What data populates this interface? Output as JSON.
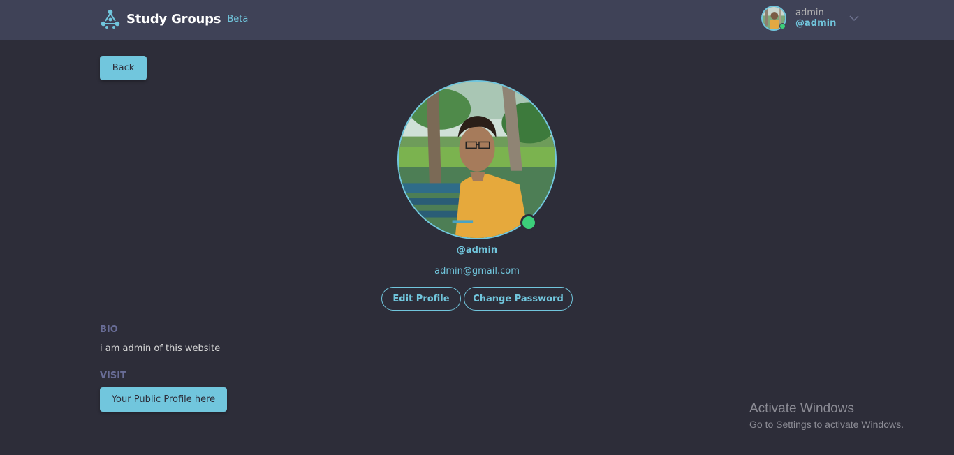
{
  "header": {
    "title": "Study Groups",
    "badge": "Beta",
    "user": {
      "name": "admin",
      "handle": "@admin"
    }
  },
  "actions": {
    "back_label": "Back"
  },
  "profile": {
    "handle": "@admin",
    "email": "admin@gmail.com",
    "status": "online",
    "edit_label": "Edit Profile",
    "password_label": "Change Password"
  },
  "bio": {
    "heading": "BIO",
    "text": "i am admin of this website"
  },
  "visit": {
    "heading": "VISIT",
    "button_label": "Your Public Profile here"
  },
  "watermark": {
    "title": "Activate Windows",
    "subtitle": "Go to Settings to activate Windows."
  },
  "colors": {
    "background": "#2d2d39",
    "header": "#3f4257",
    "accent": "#71c6dd",
    "online": "#3ccf7a",
    "muted_label": "#696d97"
  }
}
